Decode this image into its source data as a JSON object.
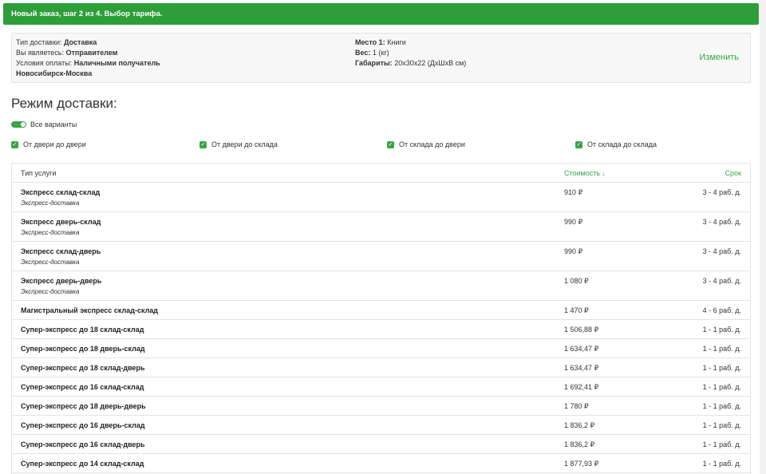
{
  "header": {
    "title": "Новый заказ, шаг 2 из 4. Выбор тарифа."
  },
  "summary": {
    "delivery_type_label": "Тип доставки:",
    "delivery_type_value": "Доставка",
    "role_label": "Вы являетесь:",
    "role_value": "Отправителем",
    "payment_label": "Условия оплаты:",
    "payment_value": "Наличными получатель",
    "route": "Новосибирск-Москва",
    "place_label": "Место 1:",
    "place_value": "Книги",
    "weight_label": "Вес:",
    "weight_value": "1 (кг)",
    "dims_label": "Габариты:",
    "dims_value": "20x30x22 (ДxШxВ см)",
    "change_label": "Изменить"
  },
  "mode": {
    "title": "Режим доставки:",
    "all_variants_label": "Все варианты",
    "all_variants_on": true,
    "options": [
      {
        "label": "От двери до двери",
        "checked": true
      },
      {
        "label": "От двери до склада",
        "checked": true
      },
      {
        "label": "От склада до двери",
        "checked": true
      },
      {
        "label": "От склада до склада",
        "checked": true
      }
    ]
  },
  "table": {
    "col_type": "Тип услуги",
    "col_cost": "Стоимость",
    "col_term": "Срок",
    "rows": [
      {
        "name": "Экспресс склад-склад",
        "sub": "Экспресс-доставка",
        "price": "910 ₽",
        "term": "3 - 4 раб. д."
      },
      {
        "name": "Экспресс дверь-склад",
        "sub": "Экспресс-доставка",
        "price": "990 ₽",
        "term": "3 - 4 раб. д."
      },
      {
        "name": "Экспресс склад-дверь",
        "sub": "Экспресс-доставка",
        "price": "990 ₽",
        "term": "3 - 4 раб. д."
      },
      {
        "name": "Экспресс дверь-дверь",
        "sub": "Экспресс-доставка",
        "price": "1 080 ₽",
        "term": "3 - 4 раб. д."
      },
      {
        "name": "Магистральный экспресс склад-склад",
        "sub": "",
        "price": "1 470 ₽",
        "term": "4 - 6 раб. д."
      },
      {
        "name": "Супер-экспресс до 18 склад-склад",
        "sub": "",
        "price": "1 506,88 ₽",
        "term": "1 - 1 раб. д."
      },
      {
        "name": "Супер-экспресс до 18 дверь-склад",
        "sub": "",
        "price": "1 634,47 ₽",
        "term": "1 - 1 раб. д."
      },
      {
        "name": "Супер-экспресс до 18 склад-дверь",
        "sub": "",
        "price": "1 634,47 ₽",
        "term": "1 - 1 раб. д."
      },
      {
        "name": "Супер-экспресс до 16 склад-склад",
        "sub": "",
        "price": "1 692,41 ₽",
        "term": "1 - 1 раб. д."
      },
      {
        "name": "Супер-экспресс до 18 дверь-дверь",
        "sub": "",
        "price": "1 780 ₽",
        "term": "1 - 1 раб. д."
      },
      {
        "name": "Супер-экспресс до 16 дверь-склад",
        "sub": "",
        "price": "1 836,2 ₽",
        "term": "1 - 1 раб. д."
      },
      {
        "name": "Супер-экспресс до 16 склад-дверь",
        "sub": "",
        "price": "1 836,2 ₽",
        "term": "1 - 1 раб. д."
      },
      {
        "name": "Супер-экспресс до 14 склад-склад",
        "sub": "",
        "price": "1 877,93 ₽",
        "term": "1 - 1 раб. д."
      }
    ]
  },
  "colors": {
    "accent": "#3aa447",
    "header_bg": "#2e9e3a"
  },
  "icons": {
    "sort": "sort-icon",
    "check": "check-icon"
  }
}
